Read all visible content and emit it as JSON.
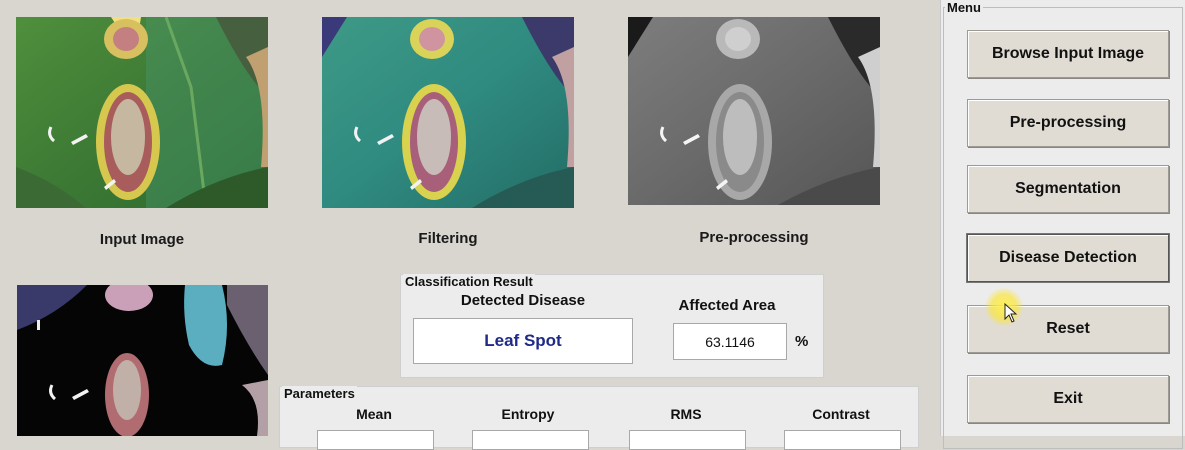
{
  "images": {
    "input_caption": "Input Image",
    "filtering_caption": "Filtering",
    "preprocessing_caption": "Pre-processing"
  },
  "menu": {
    "title": "Menu",
    "buttons": [
      {
        "label": "Browse Input Image"
      },
      {
        "label": "Pre-processing"
      },
      {
        "label": "Segmentation"
      },
      {
        "label": "Disease Detection"
      },
      {
        "label": "Reset"
      },
      {
        "label": "Exit"
      }
    ]
  },
  "classification": {
    "title": "Classification Result",
    "detected_label": "Detected Disease",
    "detected_value": "Leaf Spot",
    "area_label": "Affected Area",
    "area_value": "63.1146",
    "area_unit": "%"
  },
  "parameters": {
    "title": "Parameters",
    "labels": [
      "Mean",
      "Entropy",
      "RMS",
      "Contrast"
    ]
  },
  "colors": {
    "result_text": "#1e2a8a",
    "background": "#d9d6d0",
    "panel": "#ececec"
  }
}
